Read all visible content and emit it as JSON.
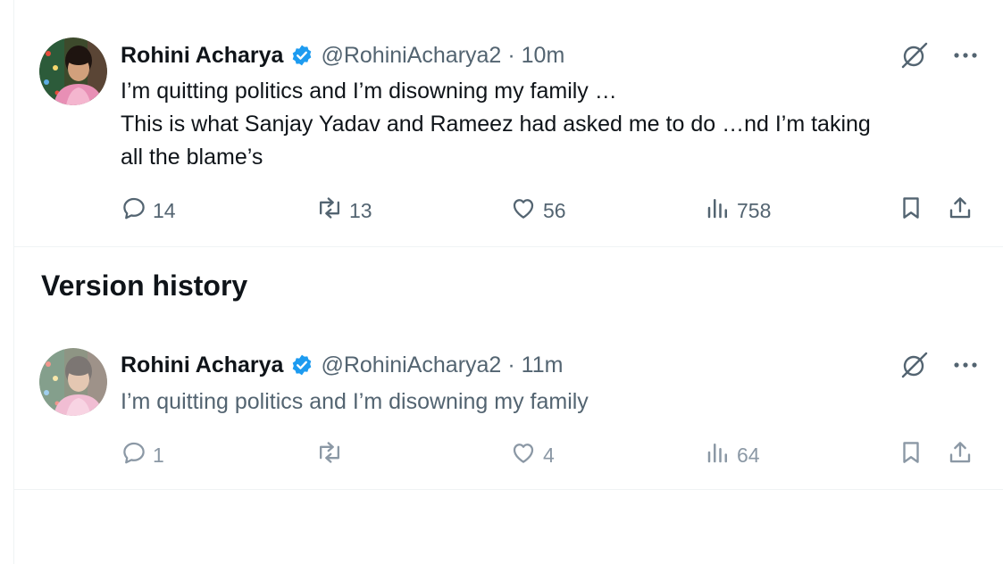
{
  "current_post": {
    "author": {
      "name": "Rohini Acharya",
      "handle": "@RohiniAcharya2",
      "separator": "·",
      "time": "10m"
    },
    "text_lines": [
      "I’m quitting politics and I’m disowning my family …",
      "This is what Sanjay Yadav and Rameez had asked me to do …nd I’m taking",
      "all the blame’s"
    ],
    "metrics": {
      "replies": "14",
      "reposts": "13",
      "likes": "56",
      "views": "758"
    }
  },
  "version_history": {
    "title": "Version history",
    "posts": [
      {
        "author": {
          "name": "Rohini Acharya",
          "handle": "@RohiniAcharya2",
          "separator": "·",
          "time": "11m"
        },
        "text_lines": [
          "I’m quitting politics and I’m disowning my family"
        ],
        "metrics": {
          "replies": "1",
          "reposts": "",
          "likes": "4",
          "views": "64"
        }
      }
    ]
  },
  "icons": {
    "verified": "verified-badge-icon",
    "grok": "grok-icon",
    "more": "more-icon",
    "reply": "reply-icon",
    "repost": "repost-icon",
    "like": "like-icon",
    "views": "views-icon",
    "bookmark": "bookmark-icon",
    "share": "share-icon"
  },
  "colors": {
    "text": "#0f1419",
    "secondary": "#536471",
    "verified": "#1d9bf0",
    "divider": "#eff3f4"
  }
}
